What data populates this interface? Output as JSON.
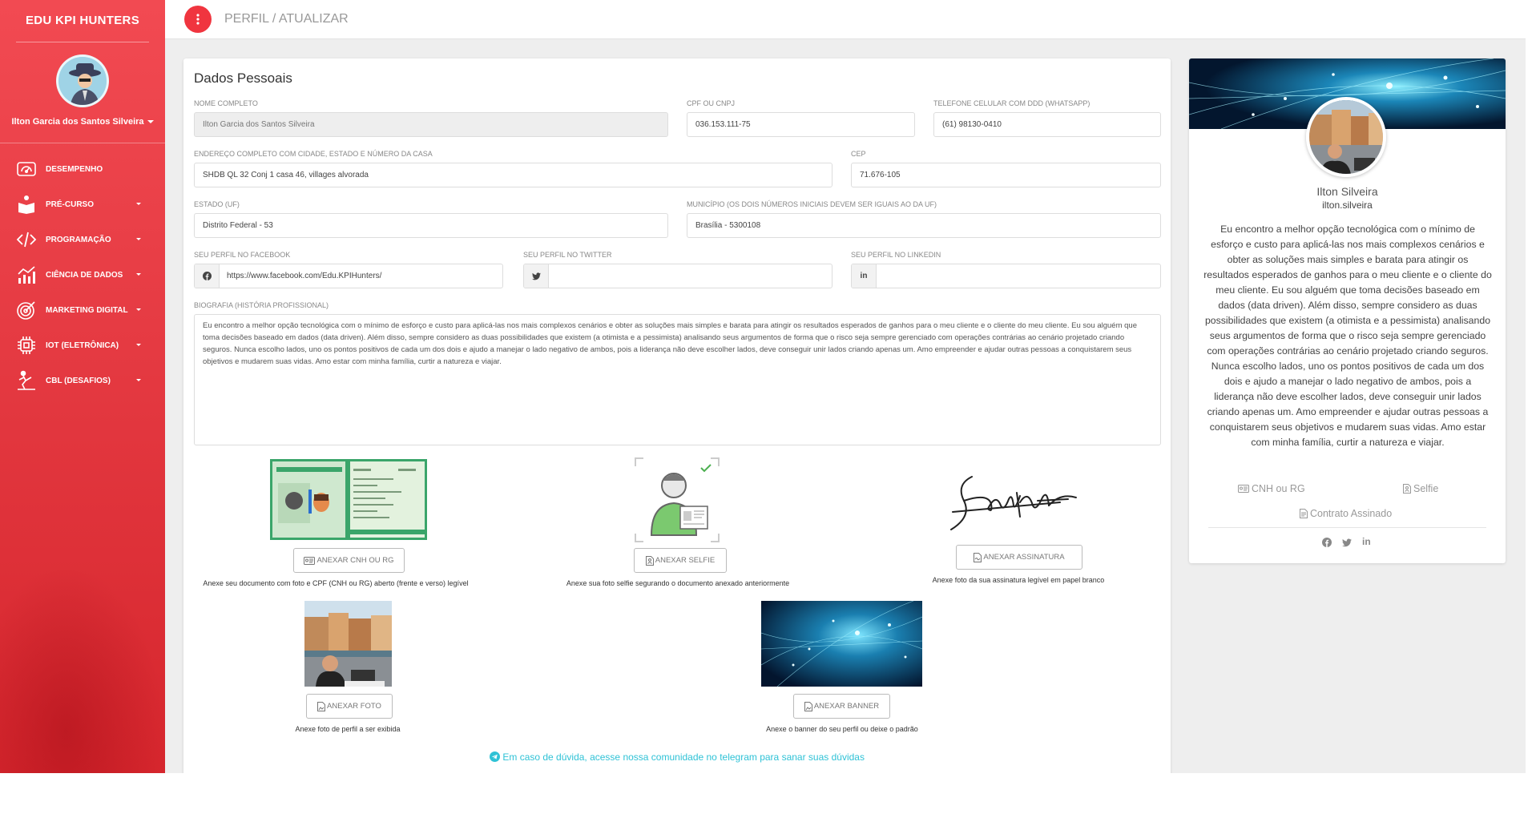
{
  "sidebar": {
    "brand": "EDU KPI HUNTERS",
    "user_name": "Ilton Garcia dos Santos Silveira",
    "items": [
      {
        "label": "DESEMPENHO",
        "icon": "dashboard-gauge-icon"
      },
      {
        "label": "PRÉ-CURSO",
        "icon": "reader-book-icon"
      },
      {
        "label": "PROGRAMAÇÃO",
        "icon": "code-icon"
      },
      {
        "label": "CIÊNCIA DE DADOS",
        "icon": "chart-growth-icon"
      },
      {
        "label": "MARKETING DIGITAL",
        "icon": "target-icon"
      },
      {
        "label": "IOT (ELETRÔNICA)",
        "icon": "chip-icon"
      },
      {
        "label": "CBL (DESAFIOS)",
        "icon": "climber-icon"
      }
    ]
  },
  "topbar": {
    "title": "PERFIL / ATUALIZAR",
    "menu_icon": "more-vertical-icon"
  },
  "form": {
    "title": "Dados Pessoais",
    "nome_label": "NOME COMPLETO",
    "nome_value": "Ilton Garcia dos Santos Silveira",
    "cpf_label": "CPF OU CNPJ",
    "cpf_value": "036.153.111-75",
    "tel_label": "TELEFONE CELULAR COM DDD (WHATSAPP)",
    "tel_value": "(61) 98130-0410",
    "endereco_label": "ENDEREÇO COMPLETO COM CIDADE, ESTADO E NÚMERO DA CASA",
    "endereco_value": "SHDB QL 32 Conj 1 casa 46, villages alvorada",
    "cep_label": "CEP",
    "cep_value": "71.676-105",
    "estado_label": "ESTADO (UF)",
    "estado_value": "Distrito Federal - 53",
    "municipio_label": "MUNICÍPIO (OS DOIS NÚMEROS INICIAIS DEVEM SER IGUAIS AO DA UF)",
    "municipio_value": "Brasília - 5300108",
    "facebook_label": "SEU PERFIL NO FACEBOOK",
    "facebook_value": "https://www.facebook.com/Edu.KPIHunters/",
    "twitter_label": "SEU PERFIL NO TWITTER",
    "twitter_value": "",
    "linkedin_label": "SEU PERFIL NO LINKEDIN",
    "linkedin_value": "",
    "bio_label": "BIOGRAFIA (HISTÓRIA PROFISSIONAL)",
    "bio_value": "Eu encontro a melhor opção tecnológica com o mínimo de esforço e custo para aplicá-las nos mais complexos cenários e obter as soluções mais simples e barata para atingir os resultados esperados de ganhos para o meu cliente e o cliente do meu cliente. Eu sou alguém que toma decisões baseado em dados (data driven). Além disso, sempre considero as duas possibilidades que existem (a otimista e a pessimista) analisando seus argumentos de forma que o risco seja sempre gerenciado com operações contrárias ao cenário projetado criando seguros. Nunca escolho lados, uno os pontos positivos de cada um dos dois e ajudo a manejar o lado negativo de ambos, pois a liderança não deve escolher lados, deve conseguir unir lados criando apenas um. Amo empreender e ajudar outras pessoas a conquistarem seus objetivos e mudarem suas vidas. Amo estar com minha família, curtir a natureza e viajar."
  },
  "attachments": {
    "cnh": {
      "button": "ANEXAR CNH OU RG",
      "caption": "Anexe seu documento com foto e CPF (CNH ou RG) aberto (frente e verso) legível"
    },
    "selfie": {
      "button": "ANEXAR SELFIE",
      "caption": "Anexe sua foto selfie segurando o documento anexado anteriormente"
    },
    "assinatura": {
      "button": "ANEXAR ASSINATURA",
      "caption": "Anexe foto da sua assinatura legível em papel branco"
    },
    "foto": {
      "button": "ANEXAR FOTO",
      "caption": "Anexe foto de perfil a ser exibida"
    },
    "banner": {
      "button": "ANEXAR BANNER",
      "caption": "Anexe o banner do seu perfil ou deixe o padrão"
    }
  },
  "help_text": "Em caso de dúvida, acesse nossa comunidade no telegram para sanar suas dúvidas",
  "profile": {
    "name": "Ilton Silveira",
    "username": "ilton.silveira",
    "bio": "Eu encontro a melhor opção tecnológica com o mínimo de esforço e custo para aplicá-las nos mais complexos cenários e obter as soluções mais simples e barata para atingir os resultados esperados de ganhos para o meu cliente e o cliente do meu cliente. Eu sou alguém que toma decisões baseado em dados (data driven). Além disso, sempre considero as duas possibilidades que existem (a otimista e a pessimista) analisando seus argumentos de forma que o risco seja sempre gerenciado com operações contrárias ao cenário projetado criando seguros. Nunca escolho lados, uno os pontos positivos de cada um dos dois e ajudo a manejar o lado negativo de ambos, pois a liderança não deve escolher lados, deve conseguir unir lados criando apenas um. Amo empreender e ajudar outras pessoas a conquistarem seus objetivos e mudarem suas vidas. Amo estar com minha família, curtir a natureza e viajar.",
    "links": {
      "cnh": "CNH ou RG",
      "selfie": "Selfie",
      "contrato": "Contrato Assinado"
    }
  },
  "colors": {
    "brand_red": "#f0353f",
    "accent_cyan": "#2fc2d6",
    "doc_green": "#3aa56a"
  }
}
